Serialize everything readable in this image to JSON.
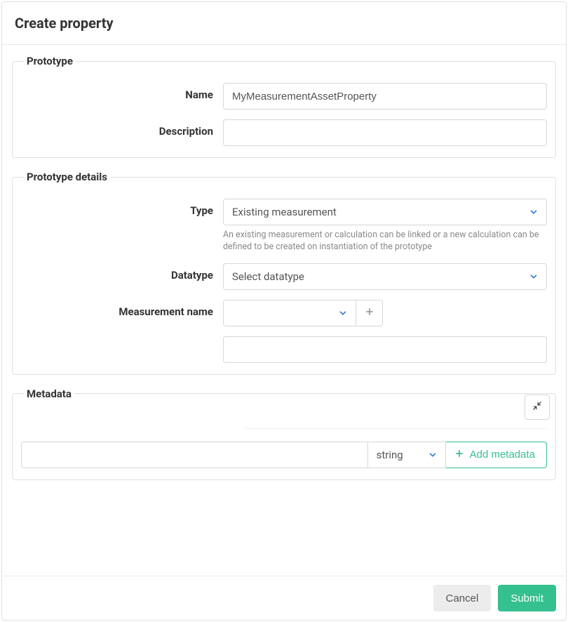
{
  "header": {
    "title": "Create property"
  },
  "sections": {
    "prototype": {
      "legend": "Prototype",
      "fields": {
        "name": {
          "label": "Name",
          "value": "MyMeasurementAssetProperty"
        },
        "description": {
          "label": "Description",
          "value": ""
        }
      }
    },
    "details": {
      "legend": "Prototype details",
      "fields": {
        "type": {
          "label": "Type",
          "value": "Existing measurement",
          "help": "An existing measurement or calculation can be linked or a new calculation can be defined to be created on instantiation of the prototype"
        },
        "datatype": {
          "label": "Datatype",
          "placeholder": "Select datatype"
        },
        "measurement": {
          "label": "Measurement name",
          "value": ""
        }
      }
    },
    "metadata": {
      "legend": "Metadata",
      "type_value": "string",
      "add_label": "Add metadata"
    }
  },
  "footer": {
    "cancel": "Cancel",
    "submit": "Submit"
  }
}
